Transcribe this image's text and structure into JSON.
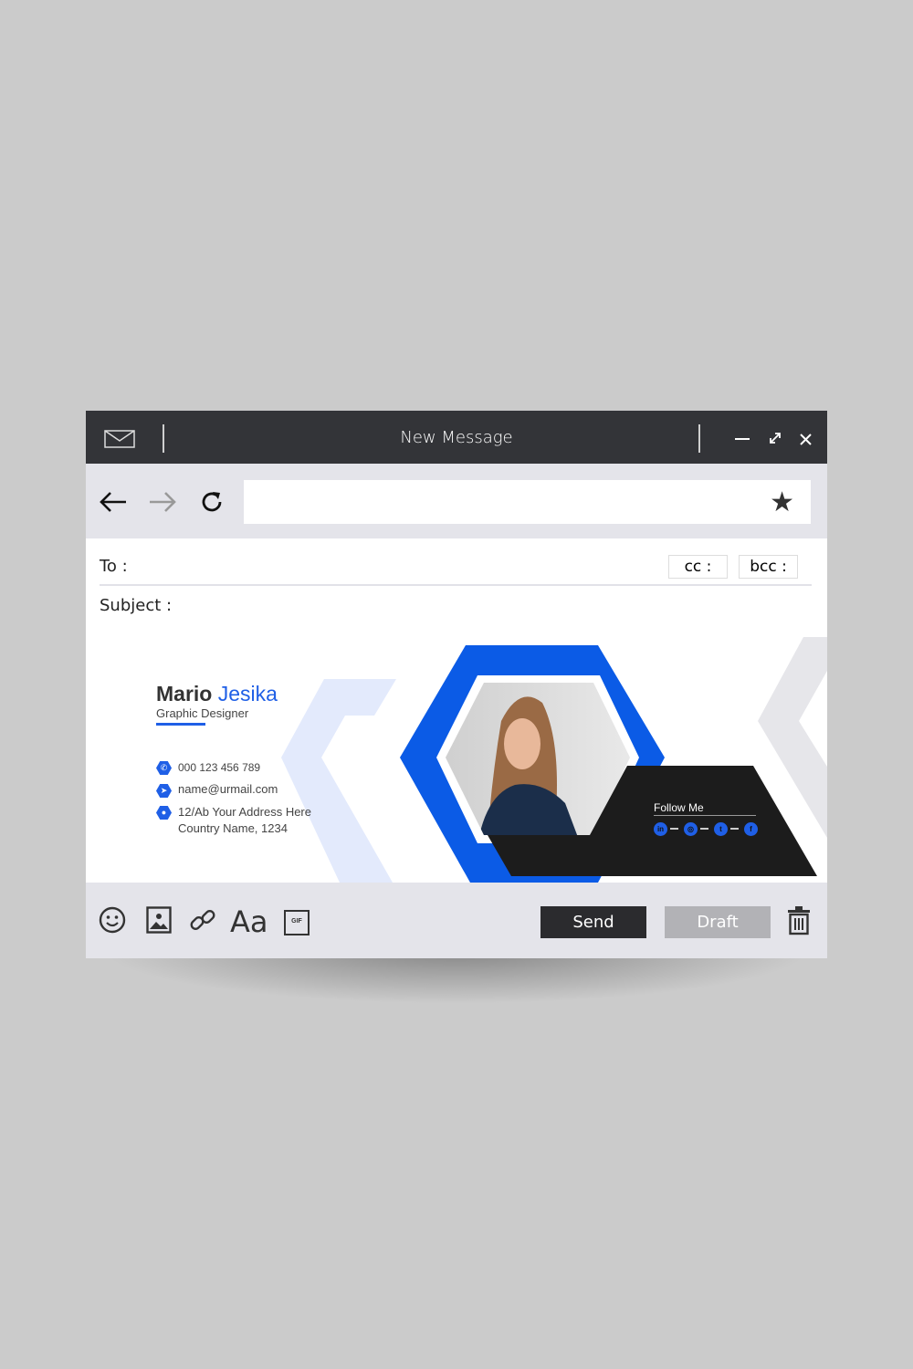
{
  "window": {
    "title": "New Message"
  },
  "titlebar": {
    "icons": [
      "mail-icon",
      "minimize-icon",
      "expand-icon",
      "close-icon"
    ]
  },
  "toolbar": {
    "address_value": "",
    "address_placeholder": "",
    "icons": [
      "back-arrow-icon",
      "forward-arrow-icon",
      "refresh-icon",
      "star-icon"
    ]
  },
  "compose": {
    "to_label": "To :",
    "cc_label": "cc :",
    "bcc_label": "bcc :",
    "subject_label": "Subject :"
  },
  "signature": {
    "first_name": "Mario",
    "last_name": "Jesika",
    "role": "Graphic Designer",
    "phone": "000 123 456 789",
    "email": "name@urmail.com",
    "address_line1": "12/Ab Your Address Here",
    "address_line2": "Country Name, 1234",
    "follow_label": "Follow Me",
    "socials": [
      "linkedin",
      "instagram",
      "twitter",
      "facebook"
    ],
    "colors": {
      "accent": "#1f5fe6",
      "dark": "#1c1c1c",
      "light_accent": "#e3eafc"
    }
  },
  "bottombar": {
    "send_label": "Send",
    "draft_label": "Draft",
    "gif_label": "GIF",
    "font_label": "Aa",
    "icons": [
      "emoji-icon",
      "image-icon",
      "link-icon",
      "font-icon",
      "gif-icon",
      "trash-icon"
    ]
  }
}
